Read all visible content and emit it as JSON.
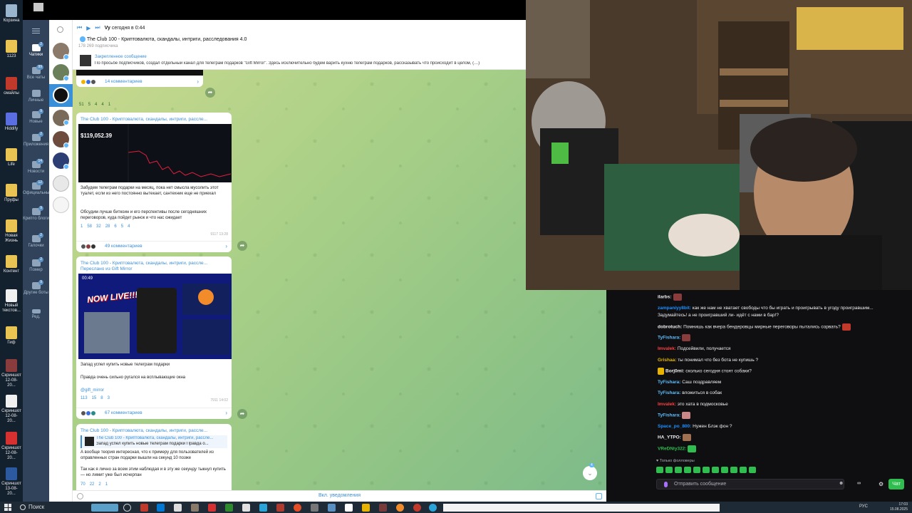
{
  "desktop": {
    "icons": [
      {
        "label": "Корзина"
      },
      {
        "label": "1123"
      },
      {
        "label": "смайлы"
      },
      {
        "label": "Hiddify"
      },
      {
        "label": "Life"
      },
      {
        "label": "Пруфы"
      },
      {
        "label": "Новая Жизнь"
      },
      {
        "label": "Контент"
      },
      {
        "label": "Новый текстов..."
      },
      {
        "label": "Гиф"
      },
      {
        "label": "Скриншот 12-08-20..."
      },
      {
        "label": "Скриншот 12-08-20..."
      },
      {
        "label": "Скриншот 12-08-20..."
      },
      {
        "label": "Скриншот 13-08-20..."
      }
    ]
  },
  "telegram": {
    "folders": [
      {
        "label": "Чатики",
        "count": "2"
      },
      {
        "label": "Все чаты",
        "count": "99"
      },
      {
        "label": "Личные",
        "count": ""
      },
      {
        "label": "Новые",
        "count": "9"
      },
      {
        "label": "Приложения",
        "count": "2"
      },
      {
        "label": "Новости",
        "count": "14"
      },
      {
        "label": "Официальные",
        "count": "12"
      },
      {
        "label": "Крипто блоги",
        "count": "9"
      },
      {
        "label": "Галочки",
        "count": "2"
      },
      {
        "label": "Помер",
        "count": "2"
      },
      {
        "label": "Другие боты",
        "count": "9"
      },
      {
        "label": "Ред.",
        "count": ""
      }
    ],
    "player": {
      "name": "Vy",
      "time": "сегодня в 0:44"
    },
    "channel": {
      "title": "The Club 100 - Криптовалюта, скандалы, интриги, расследования 4.0",
      "subscribers": "178 269 подписчика"
    },
    "pinned": {
      "label": "Закрепленное сообщение",
      "text": "По просьбе подписчиков, создал отдельный канал для телеграм подарков \"Gift Mirror\". Здесь исключительно будем варить кухню телеграм подарков, рассказывать что происходит в целом, (…)"
    },
    "top_post": {
      "comments": "14 комментариев",
      "reactions": [
        "51",
        "5",
        "4",
        "4",
        "1"
      ]
    },
    "post1": {
      "source": "The Club 100 - Криптовалюта, скандалы, интриги, рассле...",
      "price": "$119,052.39",
      "text1": "Забудем телеграм подарки на месяц, пока нет смысла мусолить этот туалет, если из него постоянно вытекает, сантехник еще не приехал",
      "text2": "Обсудим лучше биткоин и его перспективы после сегодняшних переговоров, куда пойдет рынок и что нас ожидает",
      "reactions": [
        "1",
        "58",
        "32",
        "28",
        "6",
        "5",
        "4"
      ],
      "views": "9117",
      "time": "13:28",
      "comments": "49 комментариев"
    },
    "post2": {
      "source": "The Club 100 - Криптовалюта, скандалы, интриги, рассле...",
      "forwarded": "Переслано из Gift Mirror",
      "duration": "00:49",
      "live": "NOW LIVE!!!",
      "text1": "Запад успел купить новые телеграм подарки",
      "text2": "Правда очень сильно ругался на всплывающие окна",
      "link": "@gift_mirror",
      "reactions": [
        "113",
        "15",
        "8",
        "3"
      ],
      "views": "7911",
      "time": "14:02",
      "comments": "67 комментариев"
    },
    "post3": {
      "source": "The Club 100 - Криптовалюта, скандалы, интриги, рассле...",
      "reply_source": "The Club 100 - Криптовалюта, скандалы, интриги, рассле...",
      "reply_text": "Запад успел купить новые телеграм подарки  Правда о...",
      "text1": "А вообще теория интересная, что к примеру для пользователей из оправленных стран подарки вышли на секунд 10 позже",
      "text2": "Так как я лично за всем этим наблюдая и в эту же секунду тыкнул купить — но лимит уже был исчерпан",
      "reactions": [
        "70",
        "22",
        "2",
        "1"
      ]
    },
    "mention_count": "4",
    "bottom": {
      "mute_label": "Вкл. уведомления"
    }
  },
  "stream_chat": {
    "messages": [
      {
        "user": "ilarbs:",
        "color": "#ffffff",
        "text": "",
        "emote": true
      },
      {
        "user": "zampaniyy8bit:",
        "color": "#1e90ff",
        "text": "как же нам не хватает свободы что бы играть и проигрывать в угоду проигравшим...",
        "emote": false
      },
      {
        "user": "",
        "color": "#ffffff",
        "text": "Задумайтесь! а не проигравший ли- идёт с нами в бар!?",
        "emote": false
      },
      {
        "user": "dobrotuch:",
        "color": "#ffffff",
        "text": "Помнишь как вчера бендеровцы мирные переговоры пытались сорвать?",
        "emote": true
      },
      {
        "user": "TyFishara:",
        "color": "#5fbfff",
        "text": "",
        "emote": true
      },
      {
        "user": "Imvalek:",
        "color": "#ff4040",
        "text": "Подсейвили, получается",
        "emote": false
      },
      {
        "user": "Grishaa:",
        "color": "#e6b400",
        "text": "ты понимал что без бота не купишь ?",
        "emote": false
      },
      {
        "user": "Borj0mi:",
        "color": "#ffffff",
        "text": "сколько сегодня стоят собаки?",
        "emote": false
      },
      {
        "user": "TyFishara:",
        "color": "#5fbfff",
        "text": "Саш поздравляем",
        "emote": false
      },
      {
        "user": "TyFishara:",
        "color": "#5fbfff",
        "text": "вложиться в собак",
        "emote": false
      },
      {
        "user": "Imvalek:",
        "color": "#ff4040",
        "text": "это хата в подмосковье",
        "emote": false
      },
      {
        "user": "TyFishara:",
        "color": "#5fbfff",
        "text": "",
        "emote": true
      },
      {
        "user": "Space_po_800:",
        "color": "#1e90ff",
        "text": "Нужен Блэк фон ?",
        "emote": false
      },
      {
        "user": "HA_YTPO:",
        "color": "#ffffff",
        "text": "",
        "emote": true
      },
      {
        "user": "VReDNiy322:",
        "color": "#2ebd4e",
        "text": "",
        "emote": true
      }
    ],
    "followers_only": "Только фолловеры",
    "input_placeholder": "Отправить сообщение",
    "points": "∞",
    "send_label": "Чат"
  },
  "taskbar": {
    "search_label": "Поиск",
    "lang": "РУС",
    "time": "17:03",
    "date": "15.08.2025"
  },
  "colors": {
    "telegram_accent": "#3a8fd9",
    "folder_bar": "#30435a",
    "chat_green": "#a8cf87",
    "twitch_purple": "#a970ff",
    "twitch_green": "#2ebd4e"
  }
}
